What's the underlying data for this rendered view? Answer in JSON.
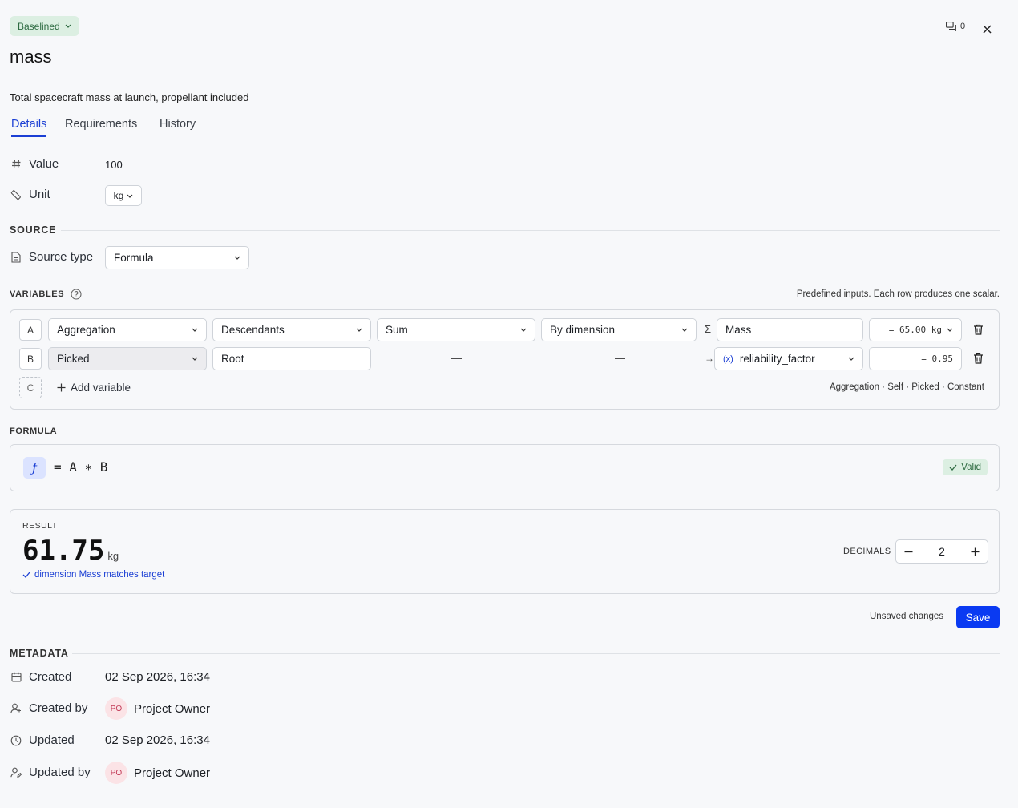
{
  "header": {
    "status": "Baselined",
    "comment_count": "0",
    "title": "mass",
    "description": "Total spacecraft mass at launch, propellant included"
  },
  "tabs": [
    {
      "label": "Details",
      "active": true
    },
    {
      "label": "Requirements",
      "active": false
    },
    {
      "label": "History",
      "active": false
    }
  ],
  "properties": {
    "value_label": "Value",
    "value": "100",
    "unit_label": "Unit",
    "unit": "kg"
  },
  "source": {
    "heading": "SOURCE",
    "type_label": "Source type",
    "type_value": "Formula"
  },
  "variables": {
    "heading": "VARIABLES",
    "hint": "Predefined inputs. Each row produces one scalar.",
    "rows": [
      {
        "letter": "A",
        "kind": "Aggregation",
        "scope": "Descendants",
        "op": "Sum",
        "group": "By dimension",
        "arrow": "Σ",
        "target": "Mass",
        "value": "= 65.00 kg"
      },
      {
        "letter": "B",
        "kind": "Picked",
        "scope": "Root",
        "op": "—",
        "group": "—",
        "arrow": "→",
        "target": "reliability_factor",
        "value": "= 0.95"
      }
    ],
    "next_letter": "C",
    "add_label": "Add variable",
    "kinds_legend": "Aggregation · Self · Picked · Constant"
  },
  "formula": {
    "heading": "FORMULA",
    "expression": "= A ∗ B",
    "status": "Valid"
  },
  "result": {
    "heading": "RESULT",
    "value": "61.75",
    "unit": "kg",
    "check": "dimension Mass matches target",
    "decimals_label": "DECIMALS",
    "decimals": "2"
  },
  "footer": {
    "unsaved": "Unsaved changes",
    "save_label": "Save"
  },
  "metadata": {
    "heading": "METADATA",
    "created_label": "Created",
    "created": "02 Sep 2026, 16:34",
    "created_by_label": "Created by",
    "created_by_initials": "PO",
    "created_by": "Project Owner",
    "updated_label": "Updated",
    "updated": "02 Sep 2026, 16:34",
    "updated_by_label": "Updated by",
    "updated_by_initials": "PO",
    "updated_by": "Project Owner"
  },
  "colors": {
    "accent": "#0a3af2",
    "status_green_bg": "#dcefe2",
    "status_green_text": "#2d6a41",
    "avatar_bg": "#fbe3e6"
  }
}
